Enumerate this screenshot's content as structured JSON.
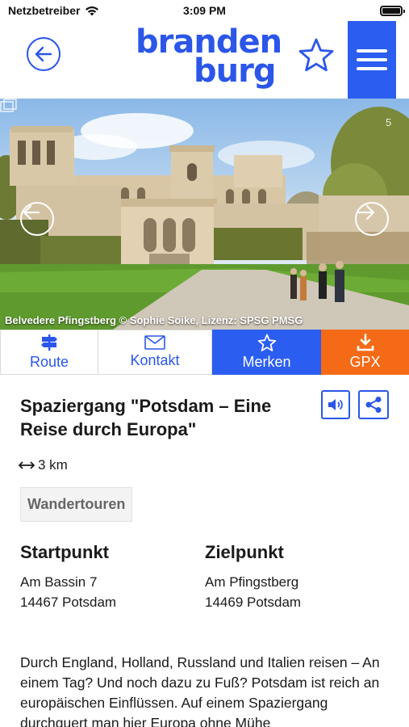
{
  "status_bar": {
    "carrier": "Netzbetreiber",
    "time": "3:09 PM"
  },
  "header": {
    "logo_line1": "branden",
    "logo_line2": "burg",
    "icons": [
      "back-arrow-icon",
      "star-icon",
      "hamburger-menu-icon"
    ]
  },
  "hero": {
    "caption": "Belvedere Pfingstberg © Sophie Soike, Lizenz: SPSG PMSG",
    "gallery_count": "5"
  },
  "actions": {
    "route": "Route",
    "kontakt": "Kontakt",
    "merken": "Merken",
    "gpx": "GPX"
  },
  "tour": {
    "title": "Spaziergang \"Potsdam – Eine Reise durch Europa\"",
    "distance": "3 km",
    "category": "Wandertouren",
    "start_heading": "Startpunkt",
    "start_line1": "Am Bassin 7",
    "start_line2": "14467 Potsdam",
    "end_heading": "Zielpunkt",
    "end_line1": "Am Pfingstberg",
    "end_line2": "14469 Potsdam",
    "description": "Durch England, Holland, Russland und Italien reisen – An einem Tag? Und noch dazu zu Fuß? Potsdam ist reich an europäischen Einflüssen. Auf einem Spaziergang durchquert man hier Europa ohne Mühe"
  },
  "colors": {
    "brand_blue": "#2b56e8",
    "merken_blue": "#2b5ef0",
    "gpx_orange": "#f46a16"
  }
}
